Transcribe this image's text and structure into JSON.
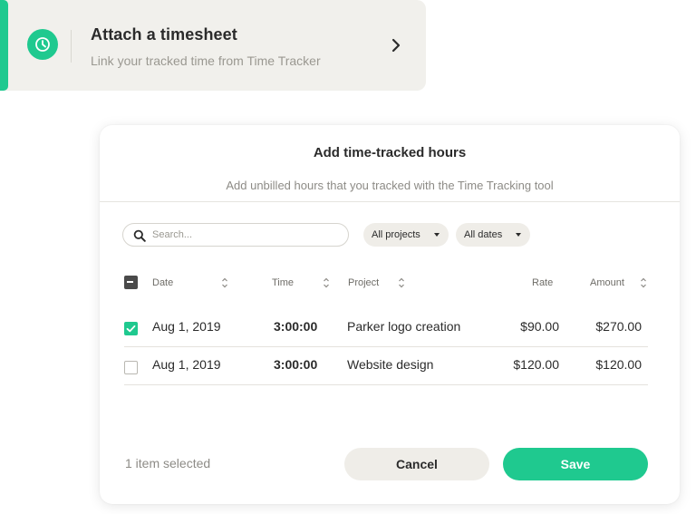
{
  "attach_card": {
    "title": "Attach a timesheet",
    "subtitle": "Link your tracked time from Time Tracker",
    "accent_color": "#1fc98f",
    "icon": "clock-icon",
    "chevron": "chevron-right-icon"
  },
  "dialog": {
    "title": "Add time-tracked hours",
    "subtitle": "Add unbilled hours that you tracked with the Time Tracking tool",
    "search": {
      "placeholder": "Search...",
      "value": ""
    },
    "filters": {
      "projects": "All projects",
      "dates": "All dates"
    },
    "columns": {
      "date": "Date",
      "time": "Time",
      "project": "Project",
      "rate": "Rate",
      "amount": "Amount"
    },
    "rows": [
      {
        "checked": true,
        "date": "Aug 1, 2019",
        "time": "3:00:00",
        "project": "Parker logo creation",
        "rate": "$90.00",
        "amount": "$270.00"
      },
      {
        "checked": false,
        "date": "Aug 1, 2019",
        "time": "3:00:00",
        "project": "Website design",
        "rate": "$120.00",
        "amount": "$120.00"
      }
    ],
    "status": "1 item selected",
    "cancel_label": "Cancel",
    "save_label": "Save"
  },
  "colors": {
    "brand_green": "#1fc98f",
    "card_bg": "#f1f0ec",
    "pill_bg": "#efede8"
  }
}
